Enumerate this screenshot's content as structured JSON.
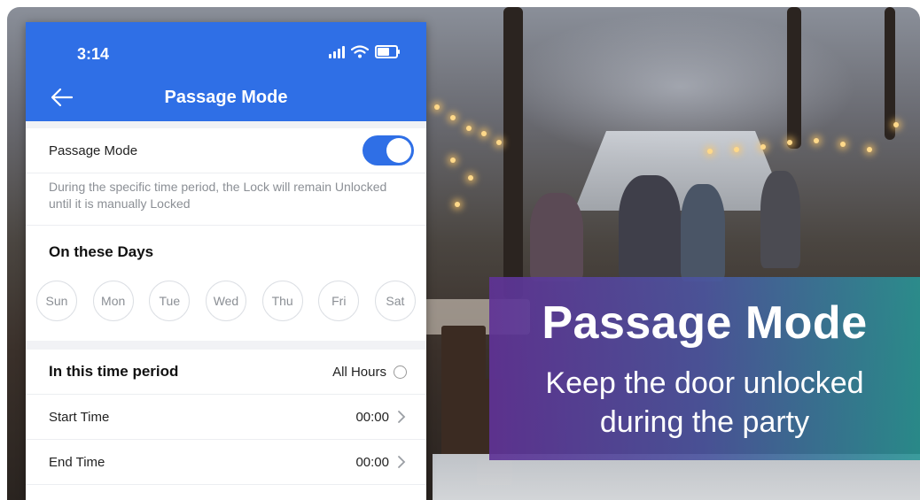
{
  "status_bar": {
    "time": "3:14"
  },
  "app_bar": {
    "title": "Passage Mode"
  },
  "passage_mode": {
    "label": "Passage Mode",
    "enabled": true,
    "description": "During the specific time period, the Lock will remain Unlocked until it is manually Locked"
  },
  "days_section": {
    "title": "On these Days",
    "days": [
      "Sun",
      "Mon",
      "Tue",
      "Wed",
      "Thu",
      "Fri",
      "Sat"
    ]
  },
  "time_period": {
    "title": "In this time period",
    "all_hours_label": "All Hours",
    "start_label": "Start Time",
    "start_value": "00:00",
    "end_label": "End Time",
    "end_value": "00:00"
  },
  "banner": {
    "title": "Passage Mode",
    "subtitle_line1": "Keep the door unlocked",
    "subtitle_line2": "during the party"
  },
  "colors": {
    "app_blue": "#2f6fe6",
    "muted_text": "#8b8f95"
  },
  "icons": [
    "back-arrow-icon",
    "signal-icon",
    "wifi-icon",
    "battery-icon",
    "chevron-right-icon",
    "radio-icon"
  ]
}
